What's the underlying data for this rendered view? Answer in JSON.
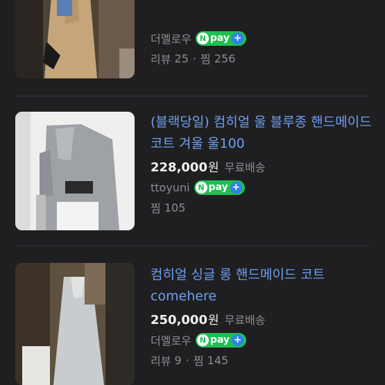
{
  "items": [
    {
      "title": "",
      "price": "",
      "won": "",
      "shipping": "",
      "seller": "더멜로우",
      "npay_label": "pay",
      "review_label": "리뷰",
      "review_count": "25",
      "like_label": "찜",
      "like_count": "256"
    },
    {
      "title": "(블랙당일) 컴히얼 울 블루종 핸드메이드 코트 겨울 울100",
      "price": "228,000",
      "won": "원",
      "shipping": "무료배송",
      "seller": "ttoyuni",
      "npay_label": "pay",
      "like_label": "찜",
      "like_count": "105"
    },
    {
      "title": "컴히얼 싱글 롱 핸드메이드 코트 comehere",
      "price": "250,000",
      "won": "원",
      "shipping": "무료배송",
      "seller": "더멜로우",
      "npay_label": "pay",
      "review_label": "리뷰",
      "review_count": "9",
      "like_label": "찜",
      "like_count": "145"
    }
  ],
  "colors": {
    "background": "#1f1f21",
    "title": "#6f9ff0",
    "npay_green": "#1fbf52",
    "npay_plus_blue": "#2f80ed",
    "muted": "#8d8d92"
  }
}
